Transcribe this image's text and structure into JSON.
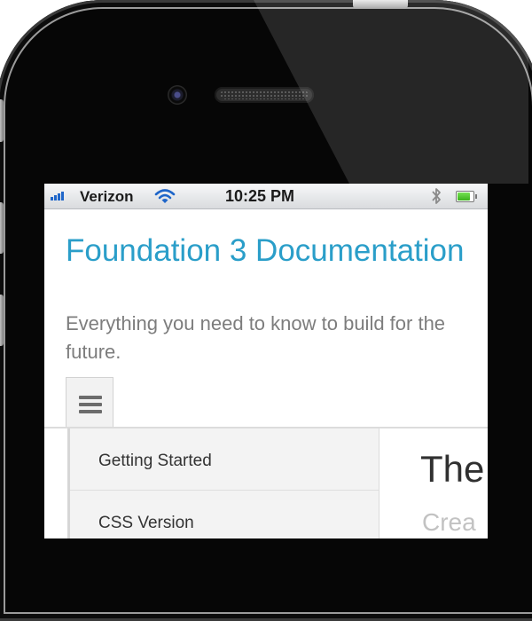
{
  "device": {
    "model": "iPhone"
  },
  "status_bar": {
    "carrier": "Verizon",
    "time": "10:25 PM",
    "signal_bars": 4,
    "battery_level": 0.85,
    "icons": [
      "signal-bars-icon",
      "wifi-icon",
      "bluetooth-icon",
      "battery-icon"
    ]
  },
  "page": {
    "title": "Foundation 3 Documentation",
    "subtitle": "Everything you need to know to build for the future.",
    "menu_icon": "hamburger-icon"
  },
  "nav": {
    "items": [
      {
        "label": "Getting Started"
      },
      {
        "label": "CSS Version"
      }
    ]
  },
  "content": {
    "heading": "The",
    "text": "Crea"
  },
  "colors": {
    "title": "#2a9ec9",
    "subtitle": "#7d7d7d",
    "signal": "#1f66c9",
    "battery": "#4cc72a",
    "phone_body": "#060606"
  }
}
